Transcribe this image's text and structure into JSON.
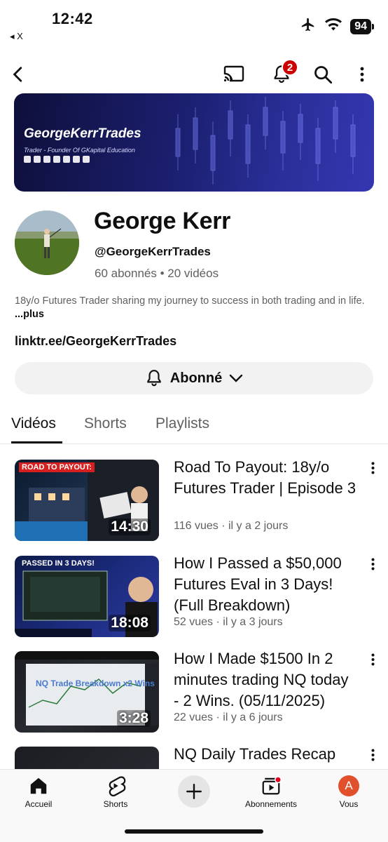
{
  "status_bar": {
    "time": "12:42",
    "back_app": "◂ X",
    "battery": "94"
  },
  "top_bar": {
    "notification_count": "2"
  },
  "banner": {
    "name": "GeorgeKerrTrades",
    "tagline": "Trader - Founder Of GKapital Education"
  },
  "channel": {
    "name": "George Kerr",
    "handle": "@GeorgeKerrTrades",
    "subscribers": "60 abonnés",
    "videos_count": "20 vidéos",
    "description": "18y/o Futures Trader sharing my journey to success in both trading and in life.",
    "more_label": "...plus",
    "link": "linktr.ee/GeorgeKerrTrades",
    "subscribe_label": "Abonné"
  },
  "tabs": [
    {
      "label": "Vidéos"
    },
    {
      "label": "Shorts"
    },
    {
      "label": "Playlists"
    }
  ],
  "videos": [
    {
      "title": "Road To Payout: 18y/o Futures Trader | Episode 3",
      "meta": "116 vues · il y a 2 jours",
      "duration": "14:30",
      "thumb_text": "ROAD TO PAYOUT:"
    },
    {
      "title": "How I Passed a $50,000 Futures Eval in 3 Days! (Full Breakdown)",
      "meta": "52 vues · il y a 3 jours",
      "duration": "18:08",
      "thumb_text": "PASSED IN 3 DAYS!"
    },
    {
      "title": "How I Made $1500 In 2 minutes trading NQ today - 2 Wins. (05/11/2025)",
      "meta": "22 vues · il y a 6 jours",
      "duration": "3:28",
      "thumb_text": "NQ Trade Breakdown x2 Wins"
    },
    {
      "title": "NQ Daily Trades Recap",
      "meta": "",
      "duration": "",
      "thumb_text": ""
    }
  ],
  "bottom_nav": {
    "home": "Accueil",
    "shorts": "Shorts",
    "subscriptions": "Abonnements",
    "you": "Vous",
    "account_initial": "A"
  }
}
